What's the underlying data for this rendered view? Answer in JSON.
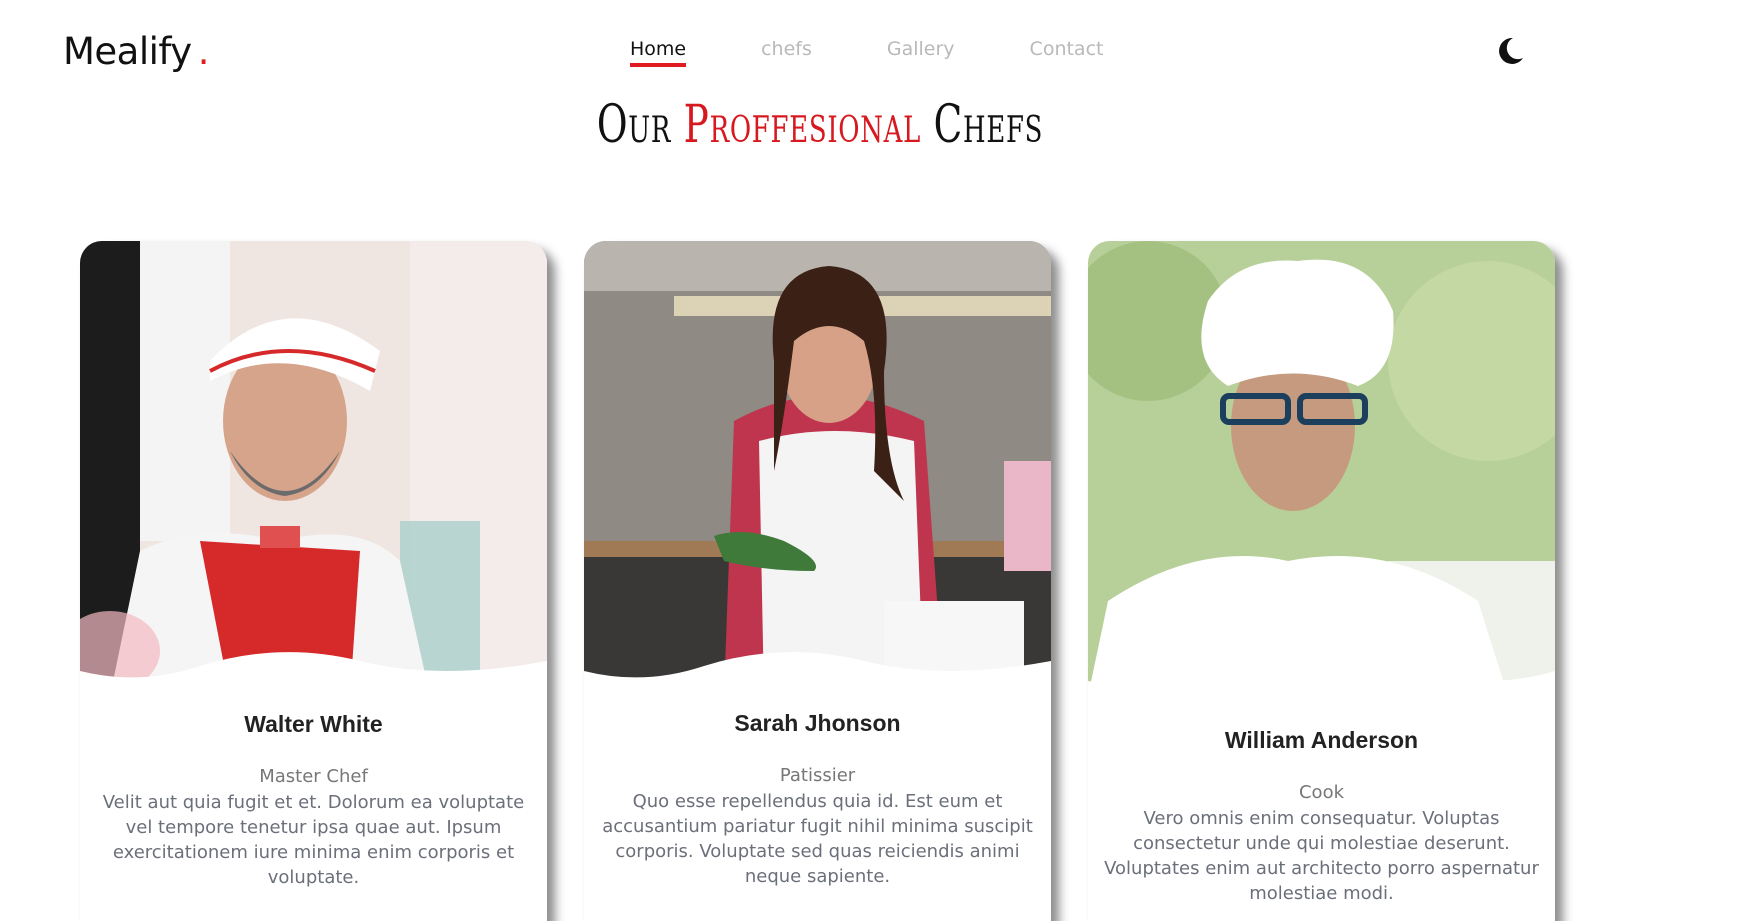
{
  "brand": {
    "name": "Mealify",
    "dot": "."
  },
  "nav": {
    "home": "Home",
    "chefs": "chefs",
    "gallery": "Gallery",
    "contact": "Contact"
  },
  "theme_icon": "moon-icon",
  "section_title": {
    "part1": "Our ",
    "accent": "Proffesional",
    "part2": " Chefs"
  },
  "colors": {
    "accent": "#e01b22",
    "text": "#111111",
    "muted": "#b9b9b9"
  },
  "chefs": [
    {
      "name": "Walter White",
      "role": "Master Chef",
      "desc": "Velit aut quia fugit et et. Dolorum ea voluptate vel tempore tenetur ipsa quae aut. Ipsum exercitationem iure minima enim corporis et voluptate."
    },
    {
      "name": "Sarah Jhonson",
      "role": "Patissier",
      "desc": "Quo esse repellendus quia id. Est eum et accusantium pariatur fugit nihil minima suscipit corporis. Voluptate sed quas reiciendis animi neque sapiente."
    },
    {
      "name": "William Anderson",
      "role": "Cook",
      "desc": "Vero omnis enim consequatur. Voluptas consectetur unde qui molestiae deserunt. Voluptates enim aut architecto porro aspernatur molestiae modi."
    }
  ]
}
